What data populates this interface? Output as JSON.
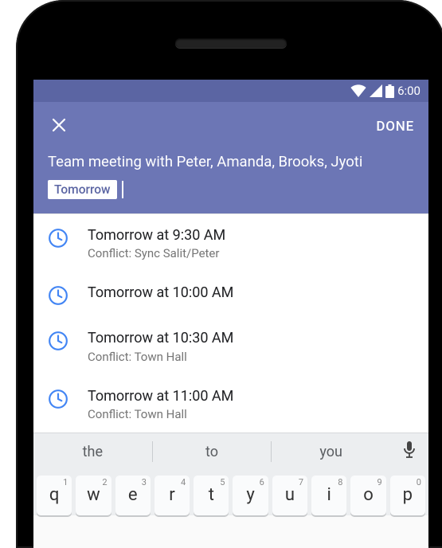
{
  "statusbar": {
    "time": "6:00"
  },
  "appbar": {
    "done_label": "DONE"
  },
  "input": {
    "title": "Team meeting with Peter, Amanda, Brooks, Jyoti",
    "chip": "Tomorrow"
  },
  "suggestions": [
    {
      "primary": "Tomorrow at 9:30 AM",
      "secondary": "Conflict: Sync Salit/Peter"
    },
    {
      "primary": "Tomorrow at 10:00 AM",
      "secondary": ""
    },
    {
      "primary": "Tomorrow at 10:30 AM",
      "secondary": "Conflict: Town Hall"
    },
    {
      "primary": "Tomorrow at 11:00 AM",
      "secondary": "Conflict: Town Hall"
    }
  ],
  "keyboard": {
    "suggestions": [
      "the",
      "to",
      "you"
    ],
    "row1": [
      {
        "k": "q",
        "n": "1"
      },
      {
        "k": "w",
        "n": "2"
      },
      {
        "k": "e",
        "n": "3"
      },
      {
        "k": "r",
        "n": "4"
      },
      {
        "k": "t",
        "n": "5"
      },
      {
        "k": "y",
        "n": "6"
      },
      {
        "k": "u",
        "n": "7"
      },
      {
        "k": "i",
        "n": "8"
      },
      {
        "k": "o",
        "n": "9"
      },
      {
        "k": "p",
        "n": "0"
      }
    ]
  }
}
